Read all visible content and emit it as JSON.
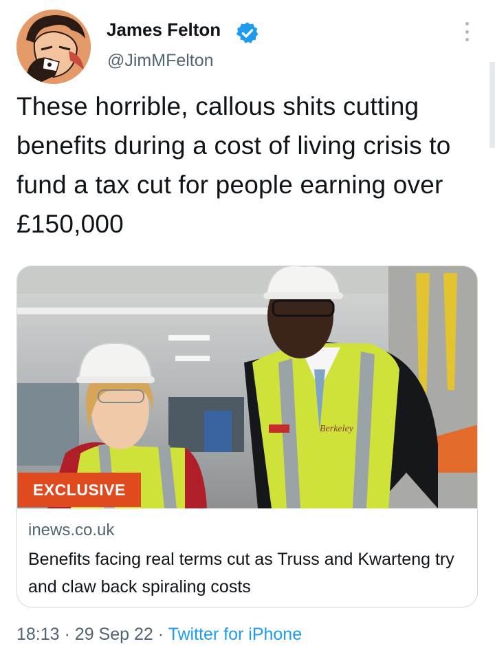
{
  "author": {
    "name": "James Felton",
    "handle": "@JimMFelton",
    "verified": true,
    "verified_color": "#1d9bf0"
  },
  "tweet": {
    "text": "These horrible, callous shits cutting benefits during a cost of living crisis to fund a tax cut for people earning over £150,000"
  },
  "link_card": {
    "badge": "EXCLUSIVE",
    "badge_color": "#e04a1e",
    "domain": "inews.co.uk",
    "title": "Benefits facing real terms cut as Truss and Kwarteng try and claw back spiraling costs",
    "vest_brand": "Berkeley"
  },
  "meta": {
    "time": "18:13",
    "separator": "·",
    "date": "29 Sep 22",
    "source": "Twitter for iPhone"
  },
  "icons": {
    "more": "more-vertical-icon",
    "verified": "verified-badge-icon"
  }
}
